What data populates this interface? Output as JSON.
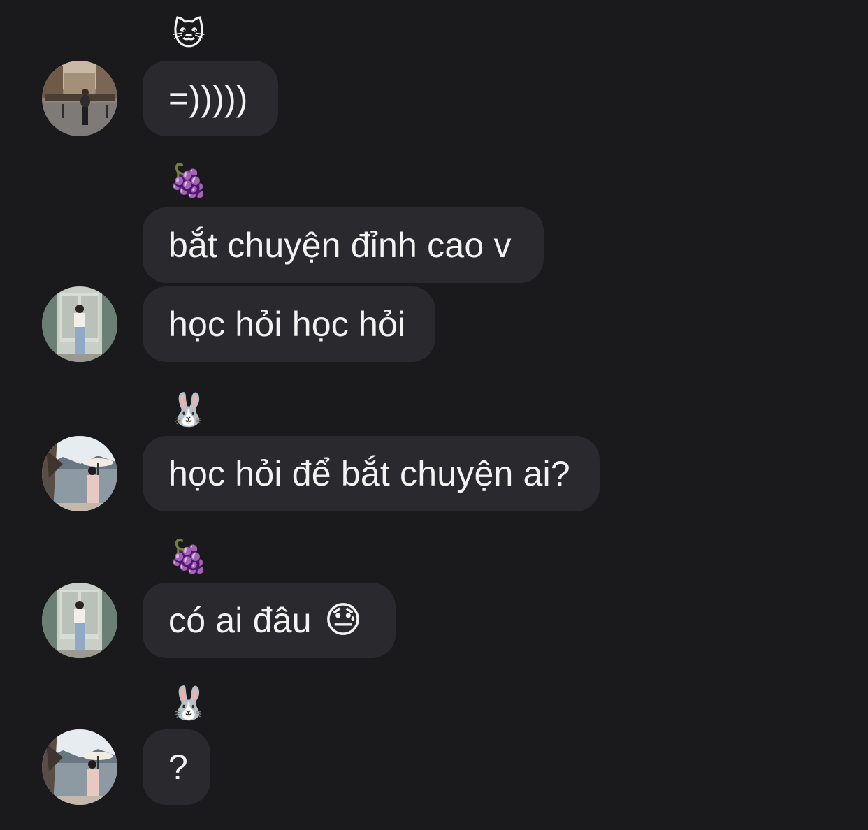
{
  "messages": [
    {
      "nickname_icon": "🐱",
      "text": "=)))))"
    },
    {
      "nickname_icon": "🍇",
      "text": "bắt chuyện đỉnh cao v"
    },
    {
      "text": "học hỏi học hỏi"
    },
    {
      "nickname_icon": "🐰",
      "text": "học hỏi để bắt chuyện ai?"
    },
    {
      "nickname_icon": "🍇",
      "text": "có ai đâu",
      "emoji": "😓"
    },
    {
      "nickname_icon": "🐰",
      "text": "?"
    }
  ]
}
